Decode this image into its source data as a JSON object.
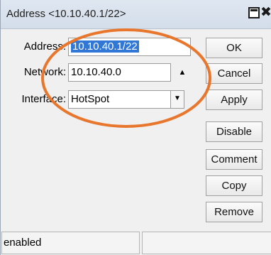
{
  "window": {
    "title": "Address <10.10.40.1/22>",
    "restore_glyph": "restore-icon",
    "close_glyph": "✖"
  },
  "form": {
    "address": {
      "label": "Address:",
      "value": "10.10.40.1/22"
    },
    "network": {
      "label": "Network:",
      "value": "10.10.40.0",
      "toggle_icon": "▲"
    },
    "interface": {
      "label": "Interface:",
      "value": "HotSpot",
      "dropdown_icon": "▼"
    }
  },
  "buttons": {
    "ok": "OK",
    "cancel": "Cancel",
    "apply": "Apply",
    "disable": "Disable",
    "comment": "Comment",
    "copy": "Copy",
    "remove": "Remove"
  },
  "status": {
    "state": "enabled",
    "right": ""
  },
  "colors": {
    "title_bg": "#d3dde9",
    "selection": "#3178d6",
    "annotation": "#e8762c"
  }
}
